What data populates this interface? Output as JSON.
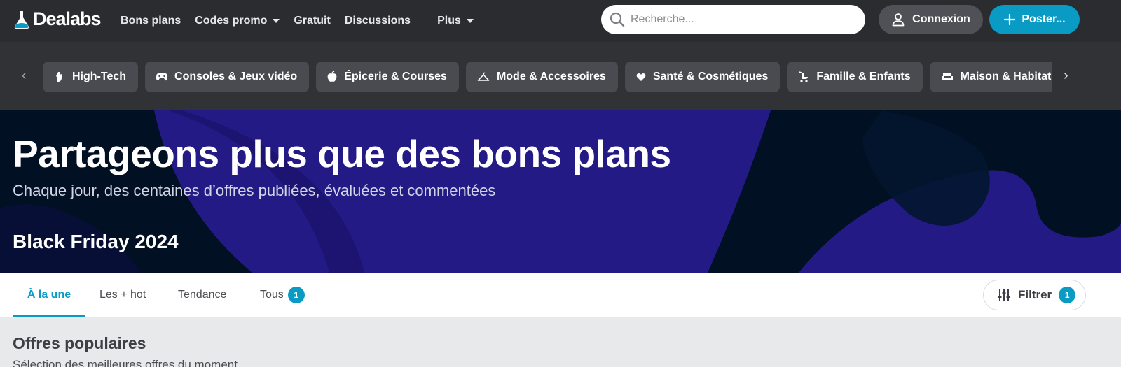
{
  "brand": {
    "name": "Dealabs"
  },
  "nav": {
    "items": [
      "Bons plans",
      "Codes promo",
      "Gratuit",
      "Discussions"
    ],
    "more_label": "Plus"
  },
  "search": {
    "placeholder": "Recherche..."
  },
  "header_buttons": {
    "login": "Connexion",
    "post": "Poster..."
  },
  "categories": [
    {
      "label": "High-Tech",
      "icon": "hand-tech-icon"
    },
    {
      "label": "Consoles & Jeux vidéo",
      "icon": "gamepad-icon"
    },
    {
      "label": "Épicerie & Courses",
      "icon": "apple-icon"
    },
    {
      "label": "Mode & Accessoires",
      "icon": "hanger-icon"
    },
    {
      "label": "Santé & Cosmétiques",
      "icon": "heart-icon"
    },
    {
      "label": "Famille & Enfants",
      "icon": "stroller-icon"
    },
    {
      "label": "Maison & Habitat",
      "icon": "sofa-icon"
    }
  ],
  "hero": {
    "title": "Partageons plus que des bons plans",
    "subtitle": "Chaque jour, des centaines d’offres publiées, évaluées et commentées",
    "event": "Black Friday 2024"
  },
  "tabs": {
    "items": [
      "À la une",
      "Les + hot",
      "Tendance",
      "Tous"
    ],
    "active": "À la une",
    "tous_badge": "1"
  },
  "filter": {
    "label": "Filtrer",
    "badge": "1"
  },
  "section": {
    "title": "Offres populaires",
    "subtitle": "Sélection des meilleures offres du moment"
  },
  "colors": {
    "accent": "#0a9bc4",
    "topbar": "#2b2c30",
    "catbar": "#313236",
    "hero_dark": "#021024",
    "hero_purple": "#241a85"
  }
}
